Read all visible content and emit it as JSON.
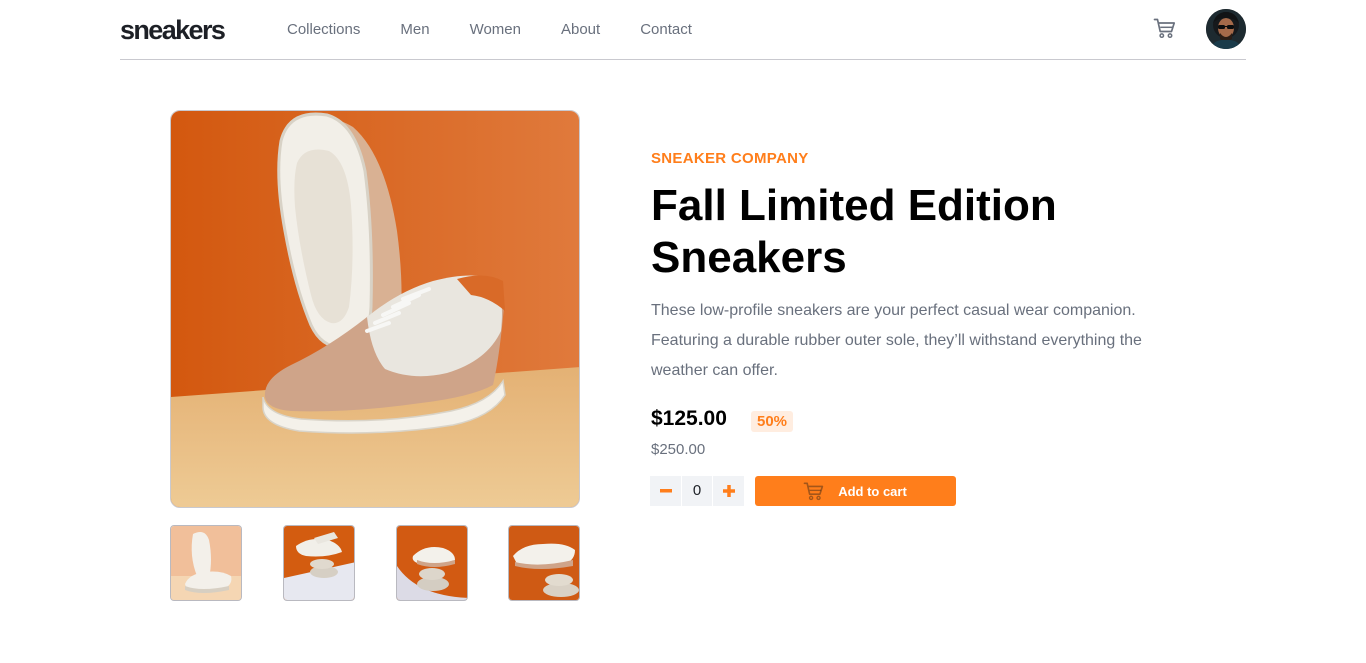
{
  "header": {
    "logo": "sneakers",
    "nav": [
      "Collections",
      "Men",
      "Women",
      "About",
      "Contact"
    ]
  },
  "product": {
    "company": "SNEAKER COMPANY",
    "title": "Fall Limited Edition Sneakers",
    "description": "These low-profile sneakers are your perfect casual wear companion. Featuring a durable rubber outer sole, they’ll withstand everything the weather can offer.",
    "price": "$125.00",
    "discount": "50%",
    "original_price": "$250.00",
    "quantity": "0",
    "add_to_cart": "Add to cart"
  },
  "colors": {
    "accent": "#ff7e1b",
    "accent_pale": "#ffede0",
    "text_dark": "#1d2026",
    "text_muted": "#69707d"
  },
  "icons": [
    "cart-icon",
    "avatar",
    "minus-icon",
    "plus-icon"
  ]
}
